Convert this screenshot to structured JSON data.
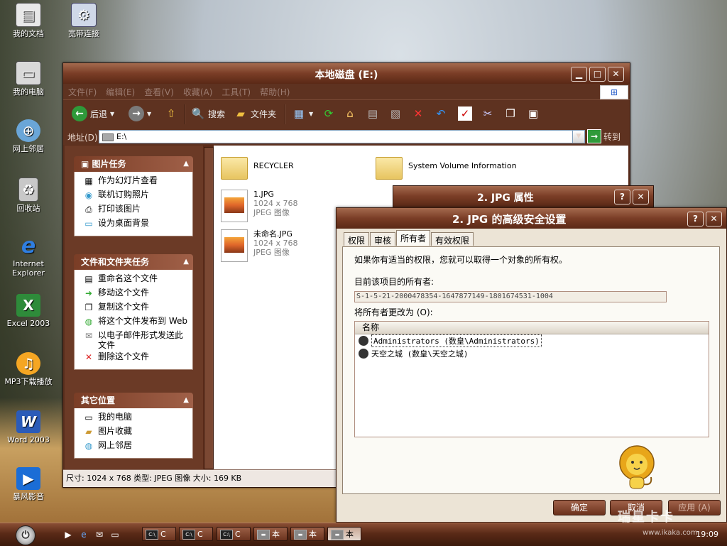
{
  "desktop_icons": [
    {
      "label": "我的文档",
      "icon": "my-documents-icon"
    },
    {
      "label": "宽带连接",
      "icon": "broadband-icon"
    },
    {
      "label": "我的电脑",
      "icon": "my-computer-icon"
    },
    {
      "label": "网上邻居",
      "icon": "network-icon"
    },
    {
      "label": "回收站",
      "icon": "recycle-bin-icon"
    },
    {
      "label": "Internet Explorer",
      "icon": "ie-icon"
    },
    {
      "label": "Excel 2003",
      "icon": "excel-icon"
    },
    {
      "label": "MP3下载播放",
      "icon": "mp3-icon"
    },
    {
      "label": "Word 2003",
      "icon": "word-icon"
    },
    {
      "label": "暴风影音",
      "icon": "media-player-icon"
    }
  ],
  "explorer": {
    "title": "本地磁盘 (E:)",
    "menu": [
      "文件(F)",
      "编辑(E)",
      "查看(V)",
      "收藏(A)",
      "工具(T)",
      "帮助(H)"
    ],
    "toolbar": {
      "back": "后退",
      "search": "搜索",
      "folders": "文件夹"
    },
    "address_label": "地址(D)",
    "address_value": "E:\\",
    "go_label": "转到",
    "panels": [
      {
        "title": "图片任务",
        "items": [
          "作为幻灯片查看",
          "联机订购照片",
          "打印该图片",
          "设为桌面背景"
        ]
      },
      {
        "title": "文件和文件夹任务",
        "items": [
          "重命名这个文件",
          "移动这个文件",
          "复制这个文件",
          "将这个文件发布到 Web",
          "以电子邮件形式发送此文件",
          "删除这个文件"
        ]
      },
      {
        "title": "其它位置",
        "items": [
          "我的电脑",
          "图片收藏",
          "网上邻居"
        ]
      }
    ],
    "files": [
      {
        "name": "RECYCLER",
        "type": "folder"
      },
      {
        "name": "System Volume Information",
        "type": "folder"
      },
      {
        "name": "1.JPG",
        "dims": "1024 x 768",
        "kind": "JPEG 图像"
      },
      {
        "name": "未命名.JPG",
        "dims": "1024 x 768",
        "kind": "JPEG 图像"
      }
    ],
    "status": "尺寸: 1024 x 768 类型: JPEG 图像 大小: 169 KB"
  },
  "props_dialog": {
    "title": "2. JPG 属性"
  },
  "security_dialog": {
    "title": "2. JPG 的高级安全设置",
    "tabs": [
      "权限",
      "审核",
      "所有者",
      "有效权限"
    ],
    "active_tab": "所有者",
    "intro": "如果你有适当的权限，您就可以取得一个对象的所有权。",
    "current_owner_label": "目前该项目的所有者:",
    "current_owner_value": "S-1-5-21-2000478354-1647877149-1801674531-1004",
    "change_owner_label": "将所有者更改为 (O):",
    "list_header": "名称",
    "owners": [
      "Administrators (数皇\\Administrators)",
      "天空之城 (数皇\\天空之城)"
    ],
    "buttons": {
      "ok": "确定",
      "cancel": "取消",
      "apply": "应用 (A)"
    }
  },
  "taskbar": {
    "buttons": [
      "C",
      "C",
      "C",
      "本",
      "本",
      "本"
    ],
    "clock": "19:09"
  },
  "watermark": {
    "main": "瑞星卡卡",
    "url": "www.ikaka.com"
  }
}
